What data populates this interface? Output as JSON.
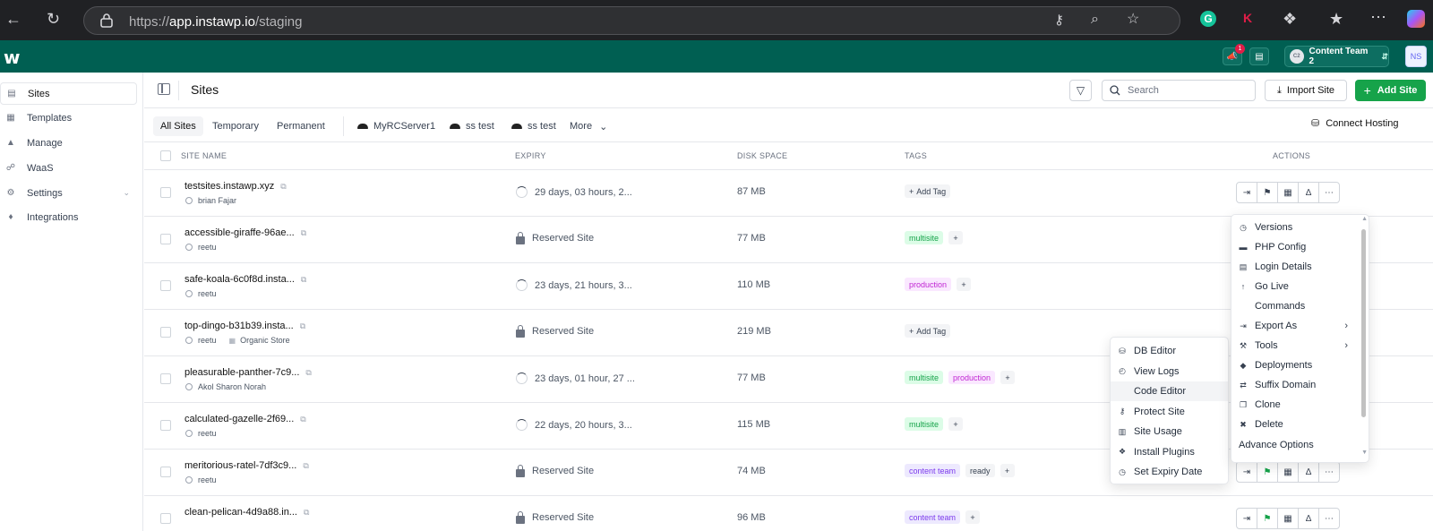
{
  "browser": {
    "url_prefix": "https://",
    "url_domain": "app.instawp.io",
    "url_path": "/staging"
  },
  "header": {
    "logo": "w",
    "notification_count": "1",
    "team_initials": "C2",
    "team_name": "Content Team 2",
    "user_initials": "NS"
  },
  "sidebar": {
    "items": [
      {
        "label": "Sites",
        "icon": "sites-icon"
      },
      {
        "label": "Templates",
        "icon": "templates-icon"
      },
      {
        "label": "Manage",
        "icon": "manage-icon"
      },
      {
        "label": "WaaS",
        "icon": "waas-icon"
      },
      {
        "label": "Settings",
        "icon": "settings-icon"
      },
      {
        "label": "Integrations",
        "icon": "integrations-icon"
      }
    ]
  },
  "page": {
    "title": "Sites",
    "search_placeholder": "Search",
    "import_label": "Import Site",
    "add_label": "Add Site"
  },
  "filters": {
    "tabs": [
      "All Sites",
      "Temporary",
      "Permanent"
    ],
    "servers": [
      "MyRCServer1",
      "ss test",
      "ss test"
    ],
    "more_label": "More",
    "connect_label": "Connect Hosting"
  },
  "table": {
    "columns": [
      "SITE NAME",
      "EXPIRY",
      "DISK SPACE",
      "TAGS",
      "ACTIONS"
    ],
    "rows": [
      {
        "name": "testsites.instawp.xyz",
        "owner": "brian Fajar",
        "extra": "",
        "expiry": "29 days, 03 hours, 2...",
        "expiry_type": "timer",
        "disk": "87 MB",
        "tags": [],
        "add_tag": "Add Tag"
      },
      {
        "name": "accessible-giraffe-96ae...",
        "owner": "reetu",
        "extra": "",
        "expiry": "Reserved Site",
        "expiry_type": "reserved",
        "disk": "77 MB",
        "tags": [
          "multisite"
        ],
        "add_tag": ""
      },
      {
        "name": "safe-koala-6c0f8d.insta...",
        "owner": "reetu",
        "extra": "",
        "expiry": "23 days, 21 hours, 3...",
        "expiry_type": "timer",
        "disk": "110 MB",
        "tags": [
          "production"
        ],
        "add_tag": ""
      },
      {
        "name": "top-dingo-b31b39.insta...",
        "owner": "reetu",
        "extra": "Organic Store",
        "expiry": "Reserved Site",
        "expiry_type": "reserved",
        "disk": "219 MB",
        "tags": [],
        "add_tag": "Add Tag"
      },
      {
        "name": "pleasurable-panther-7c9...",
        "owner": "Akol Sharon Norah",
        "extra": "",
        "expiry": "23 days, 01 hour, 27 ...",
        "expiry_type": "timer",
        "disk": "77 MB",
        "tags": [
          "multisite",
          "production"
        ],
        "add_tag": ""
      },
      {
        "name": "calculated-gazelle-2f69...",
        "owner": "reetu",
        "extra": "",
        "expiry": "22 days, 20 hours, 3...",
        "expiry_type": "timer",
        "disk": "115 MB",
        "tags": [
          "multisite"
        ],
        "add_tag": ""
      },
      {
        "name": "meritorious-ratel-7df3c9...",
        "owner": "reetu",
        "extra": "",
        "expiry": "Reserved Site",
        "expiry_type": "reserved",
        "disk": "74 MB",
        "tags": [
          "content team",
          "ready"
        ],
        "add_tag": ""
      },
      {
        "name": "clean-pelican-4d9a88.in...",
        "owner": "",
        "extra": "",
        "expiry": "Reserved Site",
        "expiry_type": "reserved",
        "disk": "96 MB",
        "tags": [
          "content team"
        ],
        "add_tag": ""
      }
    ]
  },
  "tag_colors": {
    "multisite": {
      "bg": "#dcfce7",
      "fg": "#16a34a"
    },
    "production": {
      "bg": "#fae8ff",
      "fg": "#c026d3"
    },
    "content team": {
      "bg": "#ede9fe",
      "fg": "#7c3aed"
    },
    "ready": {
      "bg": "#f3f4f6",
      "fg": "#374151"
    }
  },
  "action_menu": {
    "items": [
      {
        "label": "Versions",
        "icon": "clock-icon",
        "arrow": false
      },
      {
        "label": "PHP Config",
        "icon": "php-icon",
        "arrow": false
      },
      {
        "label": "Login Details",
        "icon": "document-icon",
        "arrow": false
      },
      {
        "label": "Go Live",
        "icon": "rocket-icon",
        "arrow": false
      },
      {
        "label": "Commands",
        "icon": "code-icon",
        "arrow": false
      },
      {
        "label": "Export As",
        "icon": "export-icon",
        "arrow": true
      },
      {
        "label": "Tools",
        "icon": "tools-icon",
        "arrow": true
      },
      {
        "label": "Deployments",
        "icon": "git-icon",
        "arrow": false
      },
      {
        "label": "Suffix Domain",
        "icon": "swap-icon",
        "arrow": false
      },
      {
        "label": "Clone",
        "icon": "copy-icon",
        "arrow": false
      },
      {
        "label": "Delete",
        "icon": "trash-icon",
        "arrow": false
      },
      {
        "label": "Advance Options",
        "icon": "",
        "arrow": false
      }
    ]
  },
  "tools_menu": {
    "items": [
      {
        "label": "DB Editor",
        "icon": "database-icon"
      },
      {
        "label": "View Logs",
        "icon": "log-icon"
      },
      {
        "label": "Code Editor",
        "icon": "code-icon"
      },
      {
        "label": "Protect Site",
        "icon": "key-icon"
      },
      {
        "label": "Site Usage",
        "icon": "usage-icon"
      },
      {
        "label": "Install Plugins",
        "icon": "puzzle-icon"
      },
      {
        "label": "Set Expiry Date",
        "icon": "clock-icon"
      }
    ]
  },
  "colors": {
    "brand": "#005f52",
    "primary_button": "#16a34a"
  }
}
